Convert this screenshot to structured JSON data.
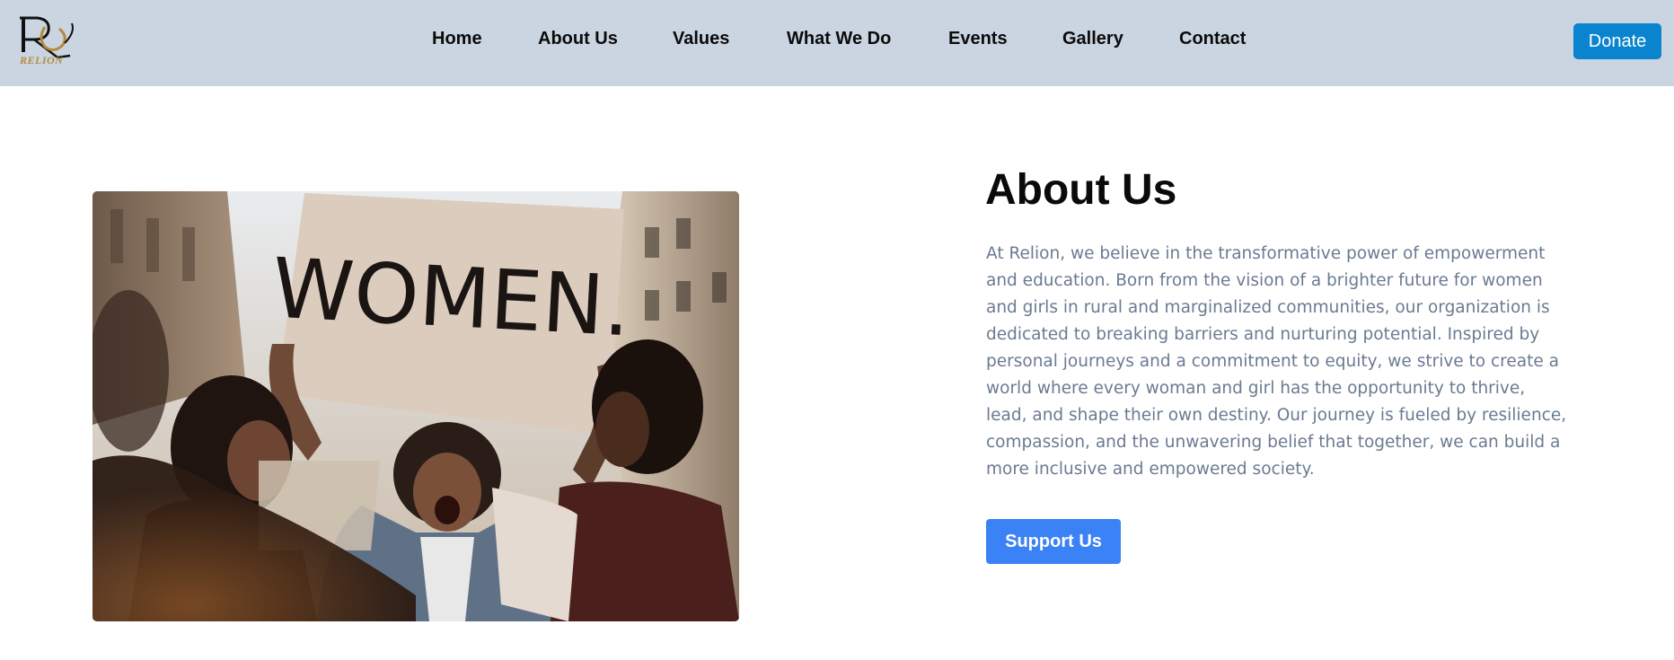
{
  "header": {
    "logo_text": "RELION",
    "nav": [
      {
        "label": "Home"
      },
      {
        "label": "About Us"
      },
      {
        "label": "Values"
      },
      {
        "label": "What We Do"
      },
      {
        "label": "Events"
      },
      {
        "label": "Gallery"
      },
      {
        "label": "Contact"
      }
    ],
    "donate_label": "Donate"
  },
  "about": {
    "image_sign_text": "WOMEN.",
    "title": "About Us",
    "body": "At Relion, we believe in the transformative power of empowerment and education. Born from the vision of a brighter future for women and girls in rural and marginalized communities, our organization is dedicated to breaking barriers and nurturing potential. Inspired by personal journeys and a commitment to equity, we strive to create a world where every woman and girl has the opportunity to thrive, lead, and shape their own destiny. Our journey is fueled by resilience, compassion, and the unwavering belief that together, we can build a more inclusive and empowered society.",
    "cta_label": "Support Us"
  },
  "colors": {
    "navbar_bg": "#cbd5e1",
    "donate_bg": "#0a84cf",
    "cta_bg": "#3b82f6",
    "body_text": "#6b7a92",
    "logo_gold": "#b58a3b"
  }
}
